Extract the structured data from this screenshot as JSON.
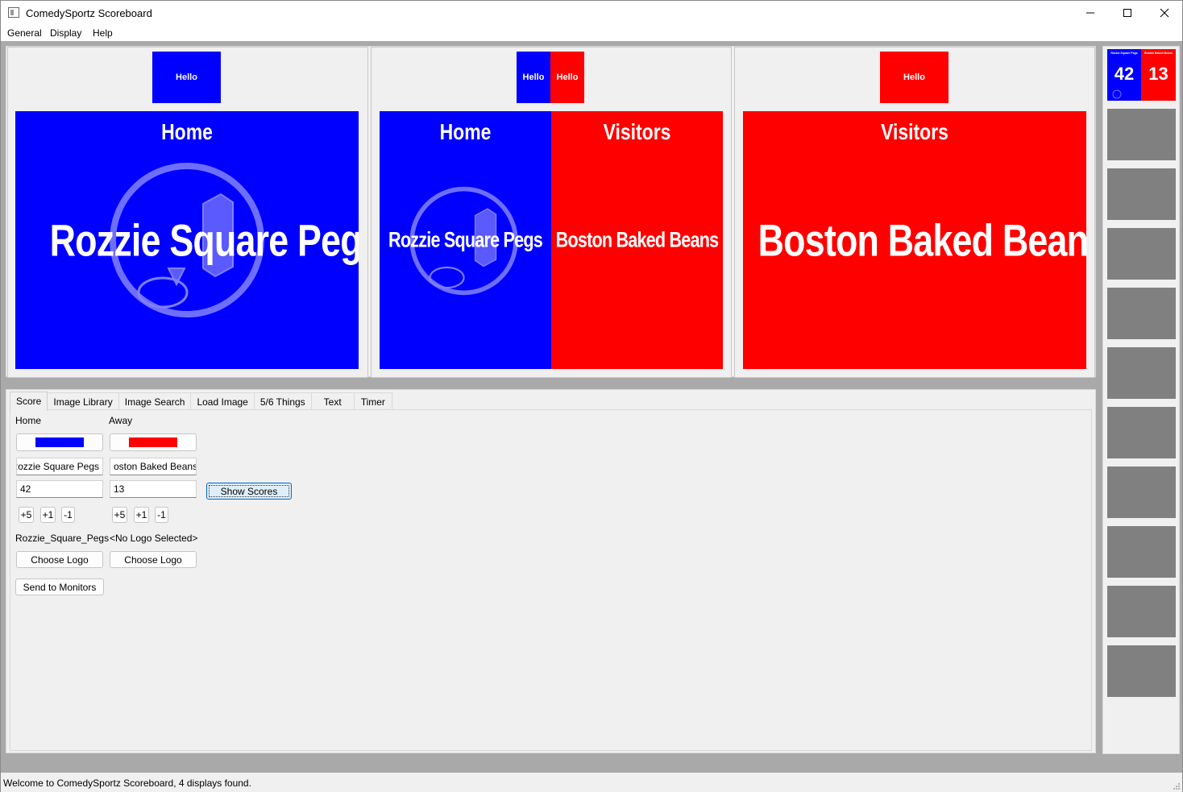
{
  "window": {
    "title": "ComedySportz Scoreboard",
    "controls": [
      "minimize",
      "maximize",
      "close"
    ]
  },
  "menu": [
    "General",
    "Display",
    "Help"
  ],
  "colors": {
    "home": "#0000ff",
    "away": "#ff0000",
    "thumb_empty": "#808080"
  },
  "previews": [
    {
      "hello": [
        "Hello"
      ],
      "label": "Home",
      "name": "Rozzie Square Pegs"
    },
    {
      "hello_left": "Hello",
      "hello_right": "Hello",
      "home_label": "Home",
      "home_name": "Rozzie Square Pegs",
      "away_label": "Visitors",
      "away_name": "Boston Baked Beans"
    },
    {
      "hello": [
        "Hello"
      ],
      "label": "Visitors",
      "name": "Boston Baked Beans"
    }
  ],
  "tabs": [
    "Score",
    "Image Library",
    "Image Search",
    "Load Image",
    "5/6 Things",
    "Text",
    "Timer"
  ],
  "score_tab": {
    "home_header": "Home",
    "away_header": "Away",
    "home_name_value": "Rozzie Square Pegs",
    "away_name_value": "oston Baked Beans",
    "home_score_value": "42",
    "away_score_value": "13",
    "show_scores": "Show Scores",
    "home_buttons": [
      "+5",
      "+1",
      "-1"
    ],
    "away_buttons": [
      "+5",
      "+1",
      "-1"
    ],
    "home_logo_file": "Rozzie_Square_Pegs.pi",
    "away_logo_file": "<No Logo Selected>",
    "choose_logo": "Choose Logo",
    "send_to_monitors": "Send to Monitors"
  },
  "sidebar": {
    "active": {
      "home_name": "Rozzie Square Pegs",
      "away_name": "Boston Baked Beans",
      "home_score": "42",
      "away_score": "13"
    },
    "empty_slots": 10
  },
  "status": "Welcome to ComedySportz Scoreboard, 4 displays found."
}
